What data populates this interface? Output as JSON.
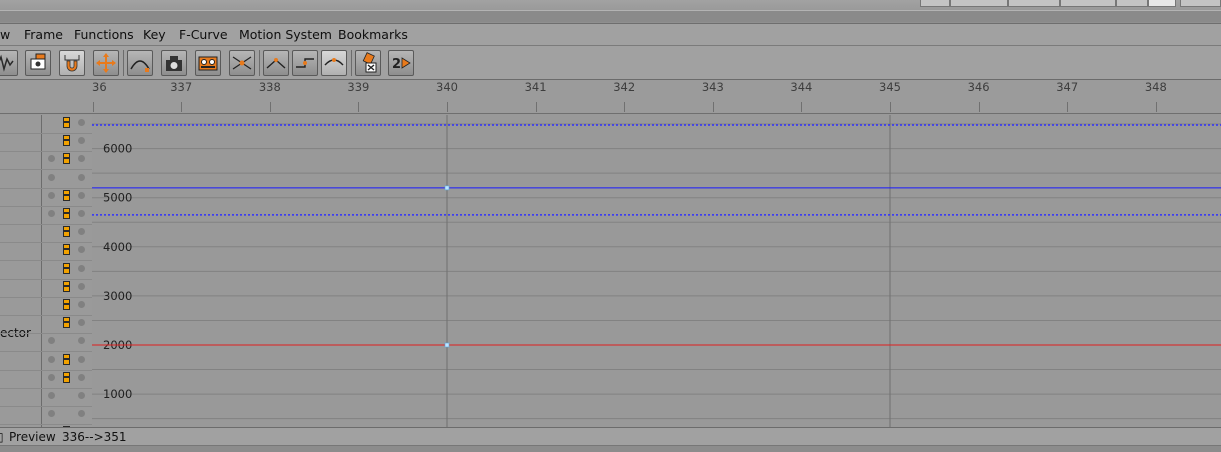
{
  "menu": {
    "items": [
      {
        "id": "view",
        "label": "w"
      },
      {
        "id": "frame",
        "label": "Frame"
      },
      {
        "id": "functions",
        "label": "Functions"
      },
      {
        "id": "key",
        "label": "Key"
      },
      {
        "id": "fcurve",
        "label": "F-Curve"
      },
      {
        "id": "motion-system",
        "label": "Motion System"
      },
      {
        "id": "bookmarks",
        "label": "Bookmarks"
      }
    ]
  },
  "toolbar": {
    "icons": [
      "fcurve-mode-icon",
      "record-key-icon",
      "snap-magnet-icon",
      "move-keys-icon",
      "curve-view-icon",
      "capture-icon",
      "tape-icon",
      "tangent-tool-icon",
      "tangent-break-icon",
      "step-tangent-icon",
      "spline-tangent-icon",
      "delete-key-icon",
      "playback-2-icon"
    ]
  },
  "timeline": {
    "frames": [
      "36",
      "337",
      "338",
      "339",
      "340",
      "341",
      "342",
      "343",
      "344",
      "345",
      "346",
      "347",
      "348"
    ]
  },
  "objects": {
    "visible_label": "ector"
  },
  "graph": {
    "y_labels": [
      "6000",
      "5000",
      "4000",
      "3000",
      "2000",
      "1000"
    ],
    "current_frame": 340,
    "curves": [
      {
        "name": "blue-solid",
        "color": "#1a1aff",
        "value": 5200
      },
      {
        "name": "blue-dotted-upper",
        "color": "#3030ff",
        "value": 6480
      },
      {
        "name": "blue-dotted-lower",
        "color": "#3030ff",
        "value": 4650
      },
      {
        "name": "red-solid",
        "color": "#e02020",
        "value": 2000
      }
    ]
  },
  "status": {
    "mode": "Preview",
    "range": "336-->351"
  },
  "colors": {
    "key_icon": "#f2a200",
    "background": "#999999",
    "grid": "#828282"
  }
}
